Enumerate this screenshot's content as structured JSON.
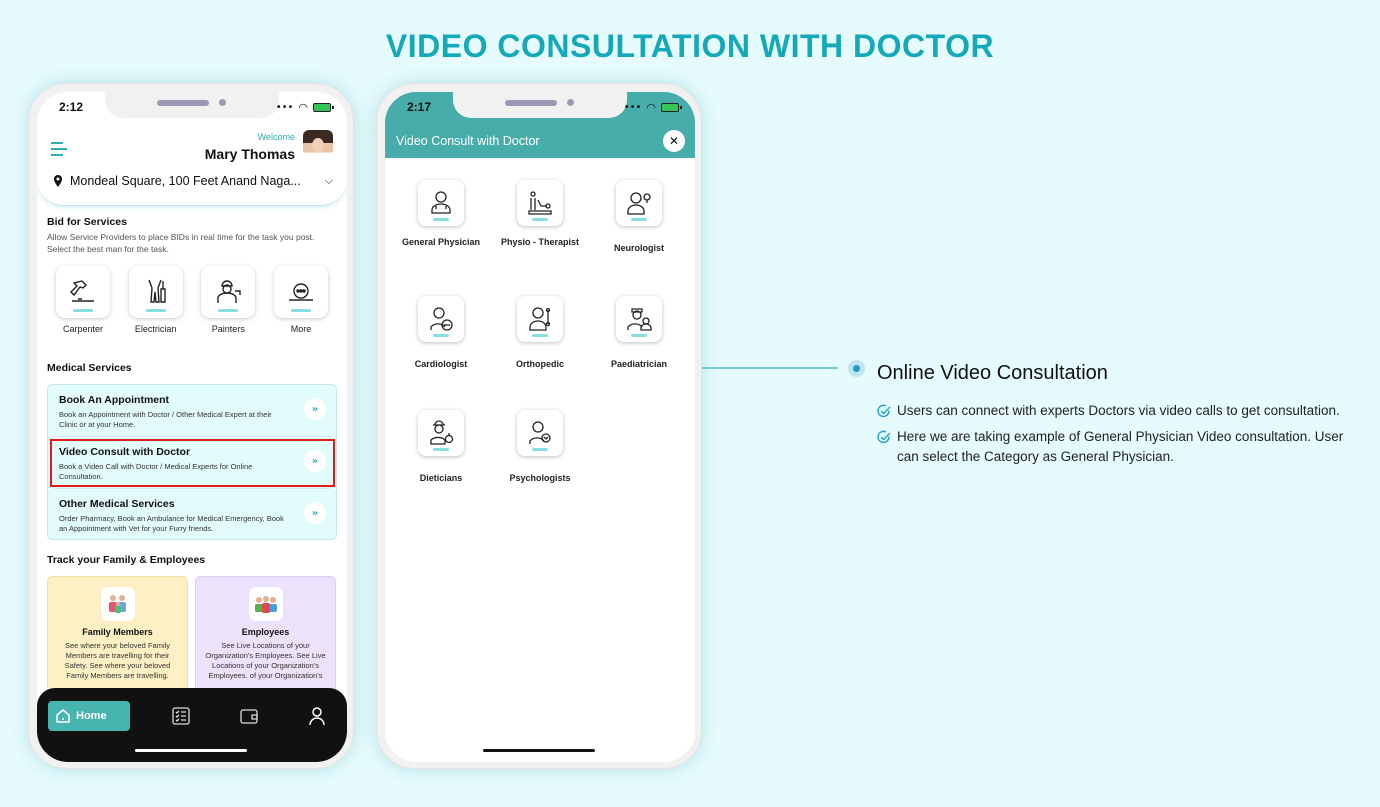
{
  "page": {
    "title": "VIDEO CONSULTATION WITH DOCTOR"
  },
  "colors": {
    "accent": "#14a9b8",
    "teal": "#47adaa",
    "highlight": "#e41b1b",
    "family_card": "#fdf0c4",
    "employees_card": "#ebe3fb"
  },
  "phone1": {
    "status": {
      "time": "2:12"
    },
    "header": {
      "welcome": "Welcome",
      "user_name": "Mary Thomas",
      "location": "Mondeal Square, 100 Feet Anand Naga..."
    },
    "bid_section": {
      "title": "Bid for Services",
      "description": "Allow Service Providers to place BIDs in real time for the task you post. Select the best man for the task.",
      "services": [
        {
          "label": "Carpenter",
          "icon": "carpenter-icon"
        },
        {
          "label": "Electrician",
          "icon": "electrician-icon"
        },
        {
          "label": "Painters",
          "icon": "painter-icon"
        },
        {
          "label": "More",
          "icon": "more-icon"
        }
      ]
    },
    "medical_section": {
      "title": "Medical Services",
      "items": [
        {
          "title": "Book An Appointment",
          "description": "Book an Appointment with Doctor / Other Medical Expert at their Clinic or at your Home."
        },
        {
          "title": "Video Consult with Doctor",
          "description": "Book a Video Call with Doctor / Medical Experts for Online Consultation."
        },
        {
          "title": "Other Medical Services",
          "description": "Order Pharmacy, Book an Ambulance for Medical Emergency, Book an Appointment with Vet for your Furry friends."
        }
      ],
      "arrow_glyph": "»"
    },
    "track_section": {
      "title": "Track your Family & Employees",
      "cards": [
        {
          "title": "Family Members",
          "description": "See where your beloved Family Members are travelling for their Safety. See where your beloved Family Members are travelling."
        },
        {
          "title": "Employees",
          "description": "See Live Locations of your Organization's Employees. See Live Locations of your Organization's Employees. of your Organization's"
        }
      ]
    },
    "tabbar": {
      "home_label": "Home",
      "tabs": [
        "home",
        "tasks",
        "wallet",
        "profile"
      ]
    }
  },
  "phone2": {
    "status": {
      "time": "2:17"
    },
    "header": {
      "title": "Video Consult with Doctor",
      "close_glyph": "✕"
    },
    "categories": [
      {
        "label": "General Physician",
        "icon": "general-physician-icon"
      },
      {
        "label": "Physio - Therapist",
        "icon": "physiotherapist-icon"
      },
      {
        "label": "Neurologist",
        "icon": "neurologist-icon"
      },
      {
        "label": "Cardiologist",
        "icon": "cardiologist-icon"
      },
      {
        "label": "Orthopedic",
        "icon": "orthopedic-icon"
      },
      {
        "label": "Paediatrician",
        "icon": "paediatrician-icon"
      },
      {
        "label": "Dieticians",
        "icon": "dietician-icon"
      },
      {
        "label": "Psychologists",
        "icon": "psychologist-icon"
      }
    ]
  },
  "annotation": {
    "title": "Online Video Consultation",
    "points": [
      "Users can connect with experts Doctors via video calls to get consultation.",
      "Here we are taking example of General Physician Video consultation. User can select the Category as General Physician."
    ]
  }
}
